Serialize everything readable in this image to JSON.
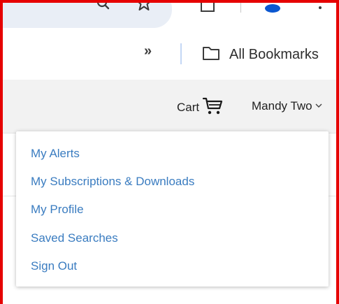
{
  "bookmarks_bar": {
    "overflow_label": "»",
    "all_bookmarks_label": "All Bookmarks"
  },
  "header": {
    "cart_label": "Cart",
    "account_name": "Mandy Two"
  },
  "account_dropdown": {
    "items": [
      {
        "label": "My Alerts"
      },
      {
        "label": "My Subscriptions & Downloads"
      },
      {
        "label": "My Profile"
      },
      {
        "label": "Saved Searches"
      },
      {
        "label": "Sign Out"
      }
    ]
  },
  "colors": {
    "frame": "#e60000",
    "link": "#3a7cc0",
    "header_bg": "#f2f2f2",
    "omnibox_bg": "#e9eef6",
    "profile_blue": "#0b57d0"
  },
  "icons": {
    "toolbar": [
      "search-icon",
      "star-icon",
      "extensions-icon",
      "profile-avatar-icon",
      "more-vert-icon"
    ],
    "bookmarks": [
      "folder-icon"
    ],
    "header": [
      "cart-icon",
      "chevron-down-icon"
    ]
  }
}
